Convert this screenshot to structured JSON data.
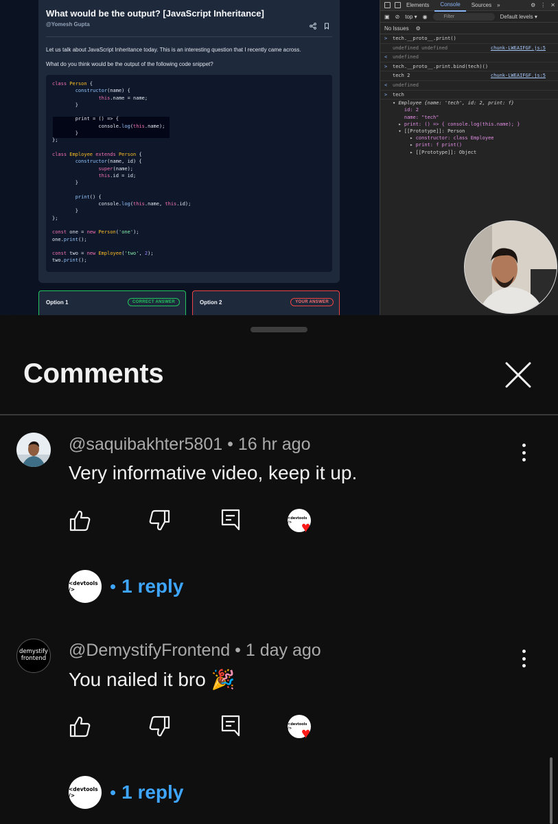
{
  "video": {
    "question_title": "What would be the output? [JavaScript Inheritance]",
    "author": "@Yomesh Gupta",
    "para1": "Let us talk about JavaScript Inheritance today. This is an interesting question that I recently came across.",
    "para2": "What do you think would be the output of the following code snippet?",
    "option1_label": "Option 1",
    "option1_badge": "CORRECT ANSWER",
    "option2_label": "Option 2",
    "option2_badge": "YOUR ANSWER"
  },
  "devtools": {
    "tabs": [
      "Elements",
      "Console",
      "Sources"
    ],
    "active_tab": "Console",
    "context": "top",
    "filter_placeholder": "Filter",
    "levels": "Default levels",
    "issues": "No Issues",
    "lines": [
      {
        "prefix": ">",
        "text": "tech.__proto__.print()",
        "src": ""
      },
      {
        "prefix": "",
        "text": "undefined undefined",
        "src": "chunk-LWEAIFGF.js:5"
      },
      {
        "prefix": "<",
        "text": "undefined",
        "src": ""
      },
      {
        "prefix": ">",
        "text": "tech.__proto__.print.bind(tech)()",
        "src": ""
      },
      {
        "prefix": "",
        "text": "tech 2",
        "src": "chunk-LWEAIFGF.js:5"
      },
      {
        "prefix": "<",
        "text": "undefined",
        "src": ""
      },
      {
        "prefix": ">",
        "text": "tech",
        "src": ""
      }
    ],
    "object_summary": "Employee {name: 'tech', id: 2, print: f}",
    "object_lines": [
      "id: 2",
      "name: \"tech\"",
      "print: () => { console.log(this.name); }",
      "[[Prototype]]: Person",
      "constructor: class Employee",
      "print: f print()",
      "[[Prototype]]: Object"
    ]
  },
  "sheet": {
    "title": "Comments",
    "comments": [
      {
        "handle": "@saquibakhter5801",
        "time": "16 hr ago",
        "text": "Very informative video, keep it up.",
        "replies": "1 reply",
        "reply_avatar_text": "<devtools />"
      },
      {
        "handle": "@DemystifyFrontend",
        "time": "1 day ago",
        "text": "You nailed it bro 🎉",
        "avatar_text": "demystify frontend",
        "replies": "1 reply",
        "reply_avatar_text": "<devtools />"
      }
    ],
    "separator": "•",
    "heart_avatar_text": "<devtools />"
  },
  "colors": {
    "background": "#0f0f0f",
    "link_blue": "#3ea6ff",
    "heart_red": "#ff1a1a"
  }
}
